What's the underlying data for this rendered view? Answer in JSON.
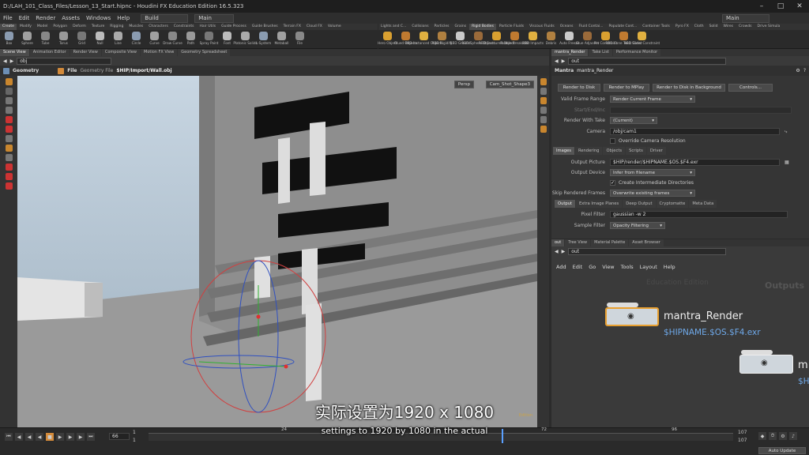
{
  "window": {
    "title": "D:/LAH_101_Class_Files/Lesson_13_Start.hipnc - Houdini FX Education Edition 16.5.323"
  },
  "menu": {
    "items": [
      "File",
      "Edit",
      "Render",
      "Assets",
      "Windows",
      "Help"
    ],
    "desktop": "Build",
    "main_left": "Main",
    "main_right": "Main"
  },
  "shelf_left": {
    "tabs": [
      "Create",
      "Modify",
      "Model",
      "Polygon",
      "Deform",
      "Texture",
      "Rigging",
      "Muscles",
      "Characters",
      "Constraints",
      "Hair Utils",
      "Guide Process",
      "Guide Brushes",
      "Terrain FX",
      "Cloud FX",
      "Volume"
    ],
    "tools": [
      "Box",
      "Sphere",
      "Tube",
      "Torus",
      "Grid",
      "Null",
      "Line",
      "Circle",
      "Curve",
      "Draw Curve",
      "Path",
      "Spray Paint",
      "Font",
      "Platonic Solids",
      "L-System",
      "Metaball",
      "File"
    ]
  },
  "shelf_right": {
    "tabs": [
      "Lights and C...",
      "Collisions",
      "Particles",
      "Grains",
      "Rigid Bodies",
      "Particle Fluids",
      "Viscous Fluids",
      "Oceans",
      "Fluid Contai...",
      "Populate Cont...",
      "Container Tools",
      "Pyro FX",
      "Cloth",
      "Solid",
      "Wires",
      "Crowds",
      "Drive Simula"
    ],
    "tools": [
      "Hero Object",
      "Glued Objects",
      "RBD Instanced Objects",
      "RBD Rigidify",
      "RBD Ground",
      "RBD Sphere Objects",
      "RBD Fractured Object",
      "Rubble Breakable",
      "RBD Impacts",
      "Debris",
      "Auto Freeze",
      "Glue Adjacent",
      "Pin Constraint",
      "RBD Cone Twist Const",
      "RBD Slider Constraint"
    ]
  },
  "viewport": {
    "tabs": [
      "Scene View",
      "Animation Editor",
      "Render View",
      "Composite View",
      "Motion FX View",
      "Geometry Spreadsheet"
    ],
    "path": "obj",
    "node_type": "Geometry",
    "node_label": "File",
    "file_label": "Geometry File",
    "file_path": "$HIP/Import/Wall.obj",
    "persp": "Persp",
    "camera": "Cam_Shot_Shape3",
    "watermark": "Edition"
  },
  "parms": {
    "tabs": [
      "mantra_Render",
      "Take List",
      "Performance Monitor"
    ],
    "path": "out",
    "node_type": "Mantra",
    "node_name": "mantra_Render",
    "buttons": [
      "Render to Disk",
      "Render to MPlay",
      "Render to Disk in Background",
      "Controls..."
    ],
    "valid_frame_range_label": "Valid Frame Range",
    "valid_frame_range": "Render Current Frame",
    "start_end_label": "Start/End/Inc",
    "render_with_take_label": "Render With Take",
    "render_with_take": "(Current)",
    "camera_label": "Camera",
    "camera": "/obj/cam1",
    "override_camera_res": "Override Camera Resolution",
    "main_tabs": [
      "Images",
      "Rendering",
      "Objects",
      "Scripts",
      "Driver"
    ],
    "output_picture_label": "Output Picture",
    "output_picture": "$HIP/render/$HIPNAME.$OS.$F4.exr",
    "output_device_label": "Output Device",
    "output_device": "Infer from filename",
    "create_intermediate": "Create Intermediate Directories",
    "skip_rendered_label": "Skip Rendered Frames",
    "skip_rendered": "Overwrite existing frames",
    "image_tabs": [
      "Output",
      "Extra Image Planes",
      "Deep Output",
      "Cryptomatte",
      "Meta Data"
    ],
    "pixel_filter_label": "Pixel Filter",
    "pixel_filter": "gaussian -w 2",
    "sample_filter_label": "Sample Filter",
    "sample_filter": "Opacity Filtering"
  },
  "network": {
    "tabs": [
      "out",
      "Tree View",
      "Material Palette",
      "Asset Browser"
    ],
    "path": "out",
    "menu": [
      "Add",
      "Edit",
      "Go",
      "View",
      "Tools",
      "Layout",
      "Help"
    ],
    "watermark": "Education Edition",
    "context_label": "Outputs",
    "node_name": "mantra_Render",
    "node_output": "$HIPNAME.$OS.$F4.exr",
    "node2_name": "m",
    "node2_output": "$H"
  },
  "timeline": {
    "frame": "66",
    "start": "1",
    "start2": "1",
    "ticks": [
      "24",
      "72",
      "96"
    ],
    "end": "107",
    "end2": "107",
    "auto_update": "Auto Update"
  },
  "subtitle": {
    "zh": "实际设置为1920 x 1080",
    "en": "settings to 1920 by 1080 in the actual"
  }
}
